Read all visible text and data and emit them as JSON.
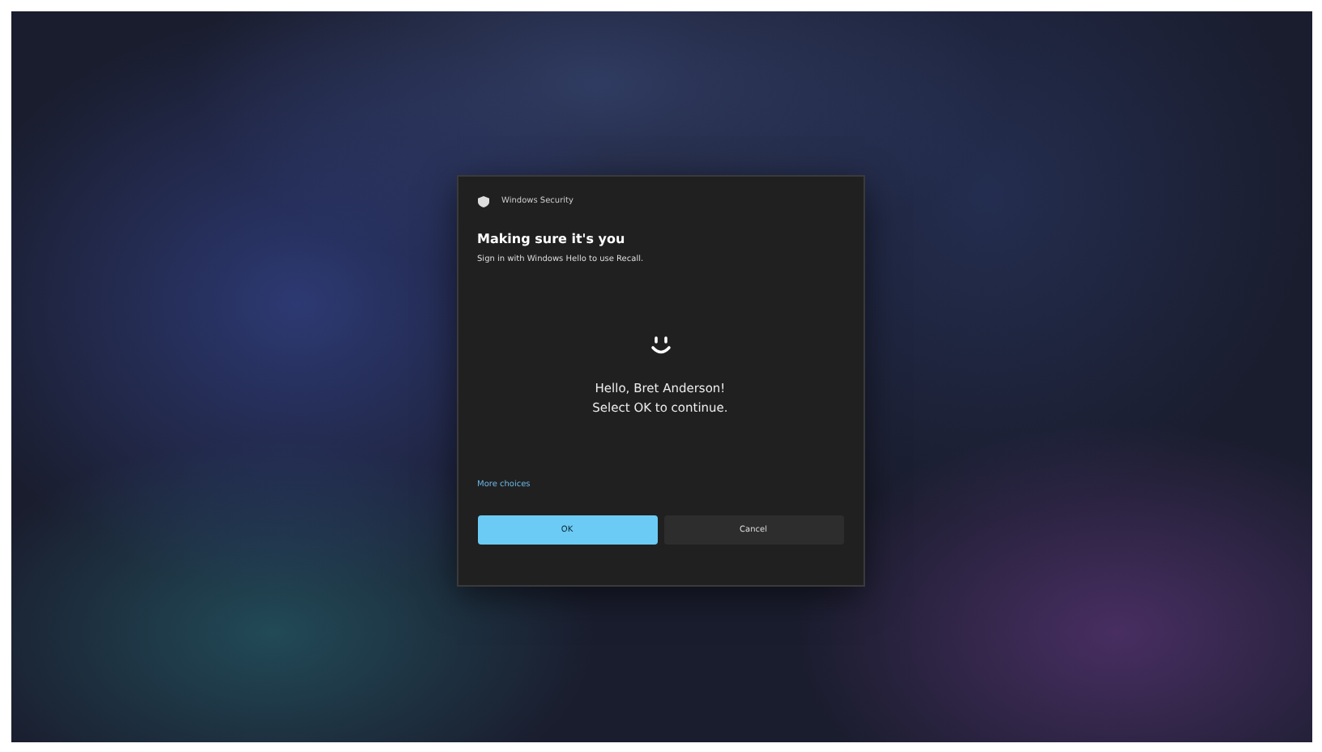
{
  "dialog": {
    "app_title": "Windows Security",
    "heading": "Making sure it's you",
    "description": "Sign in with Windows Hello to use Recall.",
    "greeting": "Hello, Bret Anderson!",
    "instruction": "Select OK to continue.",
    "more_choices": "More choices",
    "buttons": [
      {
        "label": "OK",
        "kind": "primary"
      },
      {
        "label": "Cancel",
        "kind": "secondary"
      }
    ]
  }
}
